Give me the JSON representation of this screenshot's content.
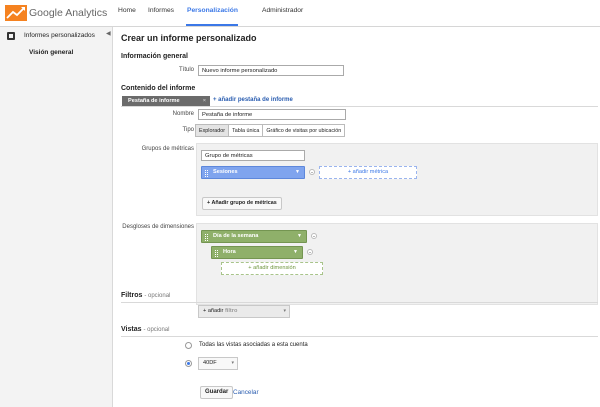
{
  "app": {
    "logo_text": "Google Analytics"
  },
  "nav": {
    "items": [
      "Home",
      "Informes",
      "Personalización",
      "Administrador"
    ],
    "active_index": 2
  },
  "sidebar": {
    "items": [
      {
        "label": "Informes personalizados",
        "icon": "custom-report-icon"
      },
      {
        "label": "Visión general"
      }
    ]
  },
  "page": {
    "title": "Crear un informe personalizado"
  },
  "general": {
    "heading": "Información general",
    "title_label": "Título",
    "title_value": "Nuevo informe personalizado"
  },
  "content": {
    "heading": "Contenido del informe",
    "tab_chip": "Pestaña de informe",
    "add_tab": "+ añadir pestaña de informe",
    "name_label": "Nombre",
    "name_value": "Pestaña de informe",
    "type_label": "Tipo",
    "type_options": [
      "Explorador",
      "Tabla única",
      "Gráfico de visitas por ubicación"
    ],
    "type_selected": 0,
    "metric_groups_label": "Grupos de métricas",
    "metric_group_name": "Grupo de métricas",
    "metric_pill": "Sesiones",
    "add_metric": "+ añadir métrica",
    "add_metric_group": "+ Añadir grupo de métricas",
    "dimensions_label": "Desgloses de dimensiones",
    "dimension_1": "Día de la semana",
    "dimension_2": "Hora",
    "add_dimension": "+ añadir dimensión"
  },
  "filters": {
    "heading": "Filtros",
    "optional": "- opcional",
    "add_prefix": "+ añadir",
    "add_placeholder": "filtro"
  },
  "views": {
    "heading": "Vistas",
    "optional": "- opcional",
    "option_all": "Todas las vistas asociadas a esta cuenta",
    "selected_view": "40DF",
    "selected_option": 1
  },
  "actions": {
    "save": "Guardar",
    "cancel": "Cancelar"
  },
  "colors": {
    "accent": "#3b78e7",
    "metric": "#7fa4ee",
    "dimension": "#8fb06a",
    "logo_orange": "#f58220"
  }
}
